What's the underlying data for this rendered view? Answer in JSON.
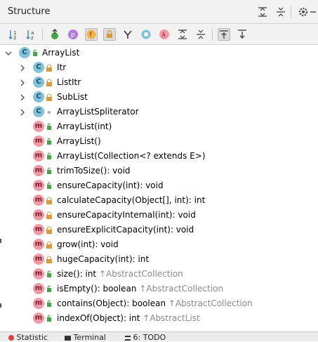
{
  "panel": {
    "title": "Structure"
  },
  "tree": {
    "root": {
      "label": "ArrayList",
      "icon": "class-icon"
    },
    "inner_classes": [
      {
        "label": "Itr",
        "visibility": "private"
      },
      {
        "label": "ListItr",
        "visibility": "private"
      },
      {
        "label": "SubList",
        "visibility": "private"
      },
      {
        "label": "ArrayListSpliterator",
        "visibility": "package"
      }
    ],
    "methods": [
      {
        "name": "ArrayList(int)",
        "inherited": "",
        "visibility": "public"
      },
      {
        "name": "ArrayList()",
        "inherited": "",
        "visibility": "public"
      },
      {
        "name": "ArrayList(Collection<? extends E>)",
        "inherited": "",
        "visibility": "public"
      },
      {
        "name": "trimToSize(): void",
        "inherited": "",
        "visibility": "public"
      },
      {
        "name": "ensureCapacity(int): void",
        "inherited": "",
        "visibility": "public"
      },
      {
        "name": "calculateCapacity(Object[], int): int",
        "inherited": "",
        "visibility": "private"
      },
      {
        "name": "ensureCapacityInternal(int): void",
        "inherited": "",
        "visibility": "private"
      },
      {
        "name": "ensureExplicitCapacity(int): void",
        "inherited": "",
        "visibility": "private"
      },
      {
        "name": "grow(int): void",
        "inherited": "",
        "visibility": "private"
      },
      {
        "name": "hugeCapacity(int): int",
        "inherited": "",
        "visibility": "private"
      },
      {
        "name": "size(): int",
        "inherited": "↑AbstractCollection",
        "visibility": "public"
      },
      {
        "name": "isEmpty(): boolean",
        "inherited": "↑AbstractCollection",
        "visibility": "public"
      },
      {
        "name": "contains(Object): boolean",
        "inherited": "↑AbstractCollection",
        "visibility": "public"
      },
      {
        "name": "indexOf(Object): int",
        "inherited": "↑AbstractList",
        "visibility": "public"
      }
    ]
  },
  "bottom_tabs": {
    "statistic": "Statistic",
    "terminal": "Terminal",
    "todo": "6: TODO"
  },
  "colors": {
    "class_icon": "#7fc2d9",
    "method_icon": "#f19aa6",
    "public": "#4aa34a",
    "private": "#d89a3a",
    "inherited_text": "#8a8a8a"
  }
}
